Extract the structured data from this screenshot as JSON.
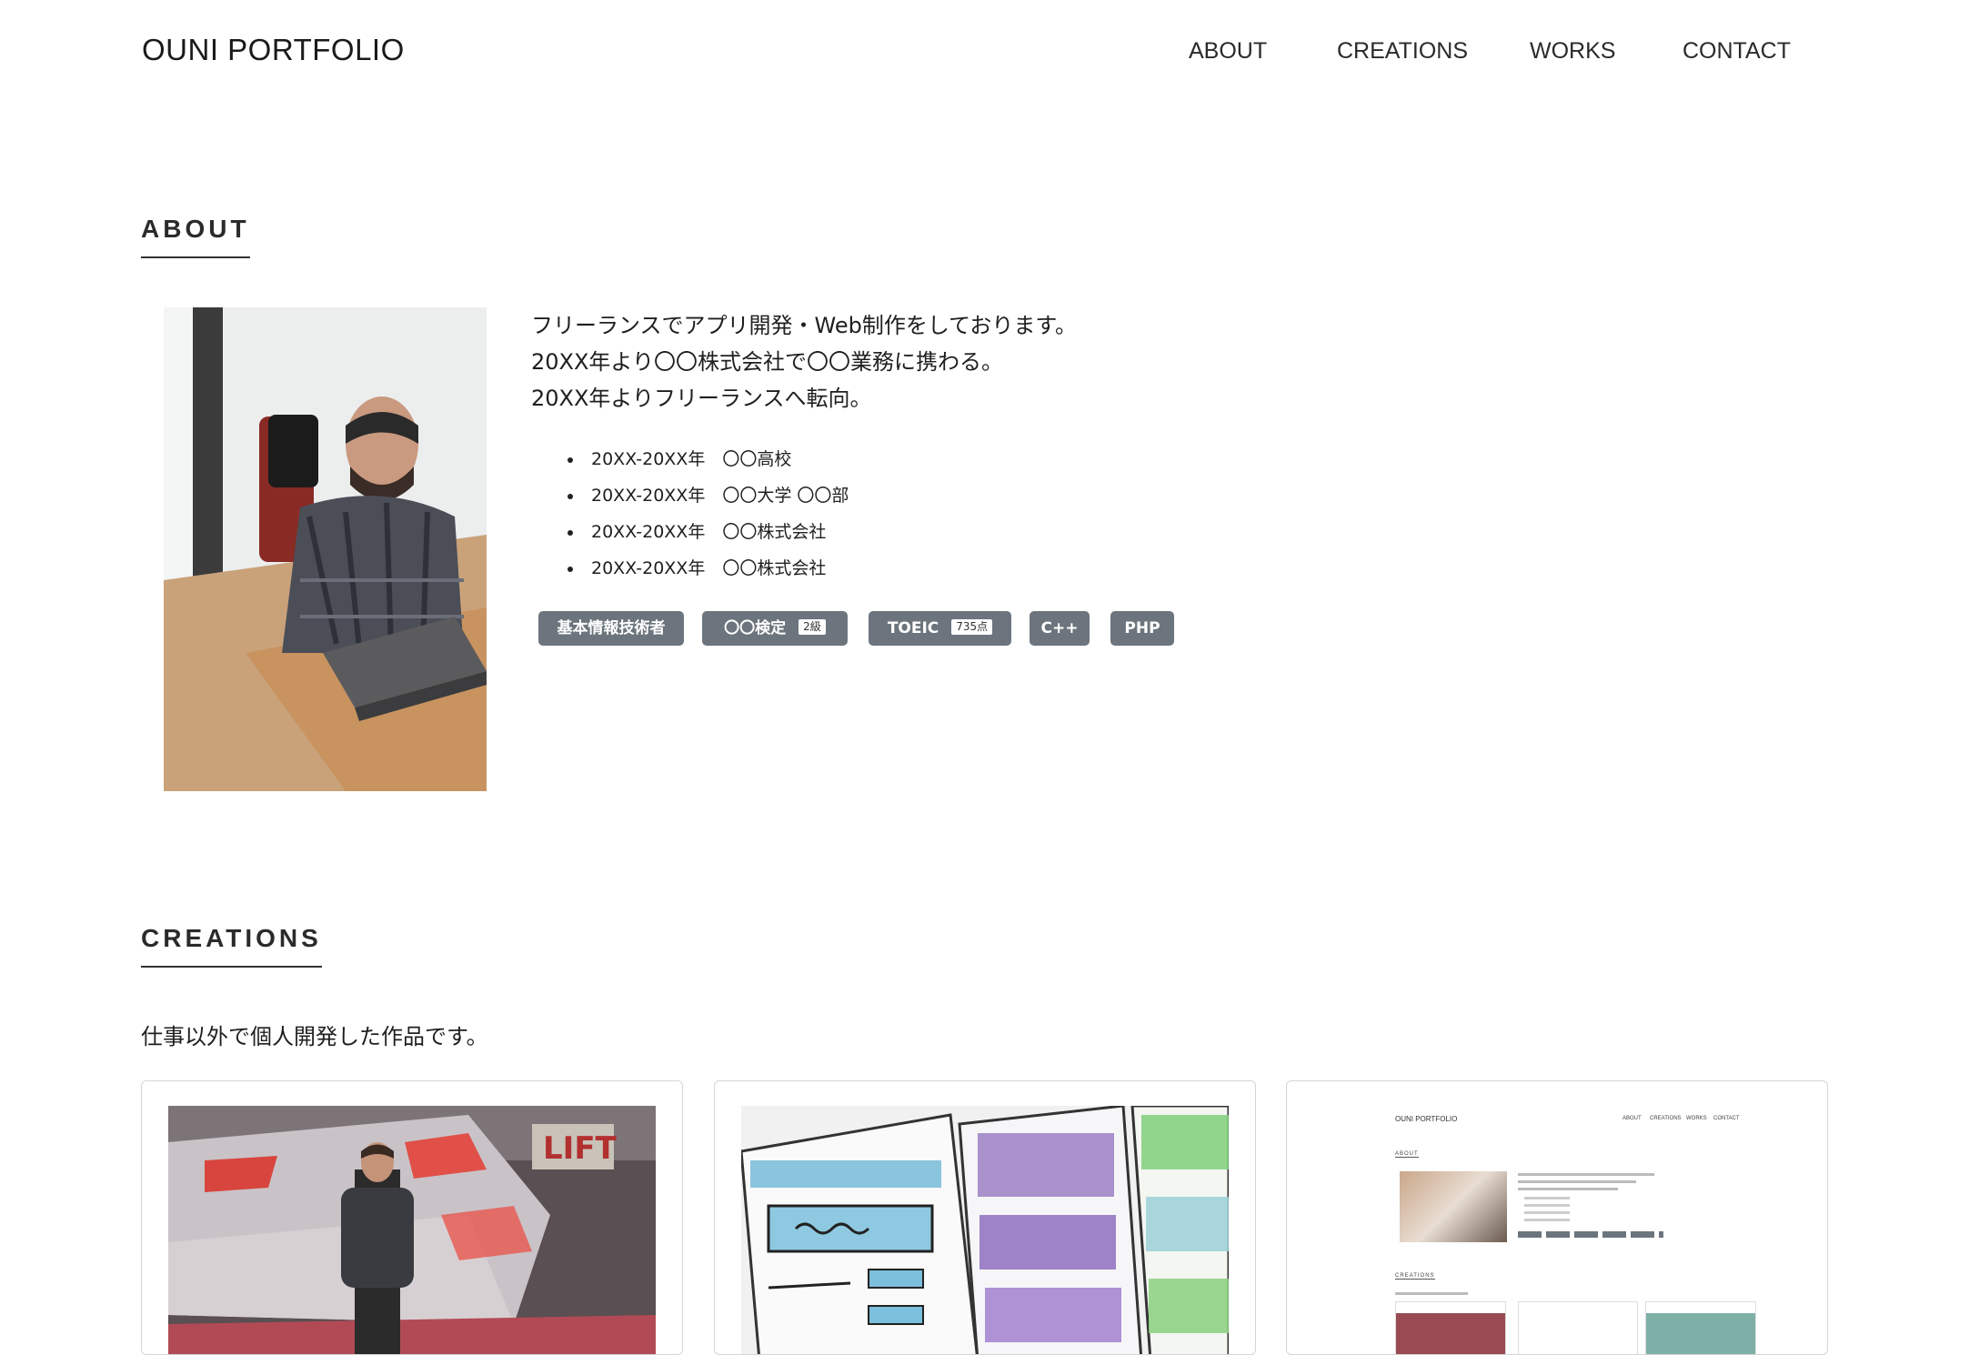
{
  "header": {
    "logo": "OUNI PORTFOLIO",
    "nav": [
      "ABOUT",
      "CREATIONS",
      "WORKS",
      "CONTACT"
    ]
  },
  "about": {
    "title": "ABOUT",
    "lines": [
      "フリーランスでアプリ開発・Web制作をしております。",
      "20XX年より〇〇株式会社で〇〇業務に携わる。",
      "20XX年よりフリーランスへ転向。"
    ],
    "history": [
      "20XX-20XX年　〇〇高校",
      "20XX-20XX年　〇〇大学 〇〇部",
      "20XX-20XX年　〇〇株式会社",
      "20XX-20XX年　〇〇株式会社"
    ],
    "badges": [
      {
        "label": "基本情報技術者",
        "sub": ""
      },
      {
        "label": "〇〇検定",
        "sub": "2級"
      },
      {
        "label": "TOEIC",
        "sub": "735点"
      },
      {
        "label": "C++",
        "sub": ""
      },
      {
        "label": "PHP",
        "sub": ""
      }
    ]
  },
  "creations": {
    "title": "CREATIONS",
    "lead": "仕事以外で個人開発した作品です。",
    "thumb_lines": {
      "logo": "OUNI PORTFOLIO",
      "nav": [
        "ABOUT",
        "CREATIONS",
        "WORKS",
        "CONTACT"
      ],
      "about": "ABOUT",
      "creations": "CREATIONS"
    }
  },
  "colors": {
    "badge_bg": "#6c757d",
    "text": "#222222",
    "card_border": "#d5d5d5"
  }
}
